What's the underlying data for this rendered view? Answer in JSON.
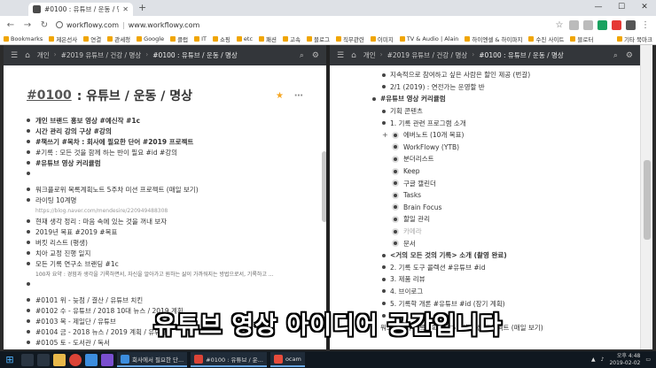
{
  "browser": {
    "tab_title": "#0100 : 유튜브 / 운동 / 명",
    "url_host": "workflowy.com",
    "url_sep": "|",
    "url_domain": "www.workflowy.com",
    "bookmarks": [
      "Bookmarks",
      "제은선사",
      "연결",
      "관세청",
      "Google",
      "클럽",
      "IT",
      "쇼핑",
      "etc",
      "패션",
      "고속",
      "블로그",
      "직무관련",
      "이미지",
      "TV & Audio | Alain",
      "하이엔셀 & 하이파지",
      "수진 사이트",
      "블로터"
    ],
    "bookmarks_right": "기타 북마크"
  },
  "left": {
    "crumbs": [
      "개인",
      "#2019 유튜브 / 건강 / 명상",
      "#0100 : 유튜브 / 운동 / 명상"
    ],
    "title_tag": "#0100",
    "title_rest": ": 유튜브 / 운동 / 명상",
    "rows": [
      {
        "text": "개인 브랜드 홍보 영상 #예신작 #1c",
        "style": "bold"
      },
      {
        "text": "시간 관리 강의 구상 #강의",
        "style": "bold"
      },
      {
        "text": "#책쓰기 #목차 : 회사에 필요한 단어 #2019 프로젝트",
        "style": "bold"
      },
      {
        "text": "#기록 : 모든 것을 함께 하는 반이 필요 #id #강의",
        "style": ""
      },
      {
        "text": "#유튜브 영상 커리큘럼",
        "style": "bold"
      },
      {
        "text": "",
        "style": ""
      },
      {
        "text": "워크플로위 목록계획노트 5주차 미션 프로젝트 (매일 보기)",
        "style": "gap"
      },
      {
        "text": "라이팅 10계명",
        "style": ""
      },
      {
        "text": "https://blog.naver.com/mendesire/220949488308",
        "style": "link"
      },
      {
        "text": "현재 생각 정리 : 마음 속에 있는 것을 꺼내 보자",
        "style": ""
      },
      {
        "text": "2019년 목표 #2019 #목표",
        "style": ""
      },
      {
        "text": "버킷 리스트 (평생)",
        "style": ""
      },
      {
        "text": "치아 교정 진행 일지",
        "style": ""
      },
      {
        "text": "모든 기록 연구소 브랜딩 #1c",
        "style": ""
      },
      {
        "text": "100자 요약 : 경험과 생각을 기록하면서, 자신을 알아가고 원하는 삶이 가까워지는 방법으로서, 기록하고 ...",
        "style": "small"
      },
      {
        "text": "",
        "style": ""
      },
      {
        "text": "#0101 위 - 늦점 / 결산 / 유튜브 치킨",
        "style": "gap"
      },
      {
        "text": "#0102 수 - 유튜브 / 2018 10대 뉴스 / 2019 계획",
        "style": ""
      },
      {
        "text": "#0103 목 - 제일단 / 유튜브",
        "style": ""
      },
      {
        "text": "#0104 금 - 2018 뉴스 / 2019 계획 / 유튜브",
        "style": ""
      },
      {
        "text": "#0105 토 - 도서관 / 독서",
        "style": ""
      }
    ]
  },
  "right": {
    "crumbs": [
      "개인",
      "#2019 유튜브 / 건강 / 명상",
      "#0100 : 유튜브 / 운동 / 명상"
    ],
    "rows": [
      {
        "text": "지속적으로 참여하고 싶은 사람은 할인 제공 (번갈)",
        "indent": 1,
        "style": ""
      },
      {
        "text": "2/1 (2019) : 연전가는 운영할 반",
        "indent": 1,
        "style": ""
      },
      {
        "text": "#유튜브 영상 커리큘럼",
        "indent": 0,
        "style": "bold"
      },
      {
        "text": "기획 콘텐츠",
        "indent": 1,
        "style": ""
      },
      {
        "text": "1. 기록 관련 프로그램 소개",
        "indent": 1,
        "style": ""
      },
      {
        "text": "에버노트 (10개 목표)",
        "indent": 2,
        "style": "expand"
      },
      {
        "text": "WorkFlowy (YTB)",
        "indent": 2,
        "style": ""
      },
      {
        "text": "분더리스트",
        "indent": 2,
        "style": ""
      },
      {
        "text": "Keep",
        "indent": 2,
        "style": ""
      },
      {
        "text": "구글 캘린더",
        "indent": 2,
        "style": ""
      },
      {
        "text": "Tasks",
        "indent": 2,
        "style": ""
      },
      {
        "text": "Brain Focus",
        "indent": 2,
        "style": ""
      },
      {
        "text": "할일 관리",
        "indent": 2,
        "style": ""
      },
      {
        "text": "카메라",
        "indent": 2,
        "style": "dim"
      },
      {
        "text": "문서",
        "indent": 2,
        "style": ""
      },
      {
        "text": "<거의 모든 것의 기록> 소개 (촬영 완료)",
        "indent": 1,
        "style": "bold"
      },
      {
        "text": "2. 기록 도구 콜렉션 #유튜브 #id",
        "indent": 1,
        "style": ""
      },
      {
        "text": "3. 제품 리뷰",
        "indent": 1,
        "style": ""
      },
      {
        "text": "4. 브이로그",
        "indent": 1,
        "style": ""
      },
      {
        "text": "5. 기록학 개론 #유튜브 #id (장기 계획)",
        "indent": 1,
        "style": ""
      },
      {
        "text": "",
        "indent": 1,
        "style": ""
      },
      {
        "text": "워크플로위 목록계획노트 5주차 미션 프로젝트 (매일 보기)",
        "indent": 0,
        "style": ""
      }
    ]
  },
  "subtitle": "유튜브 영상 아이디어 공간입니다",
  "taskbar": {
    "tasks": [
      "회사에서 필요한 단...",
      "#0100 : 유튜브 / 운...",
      "ocam"
    ],
    "time": "오후 4:48",
    "date": "2019-02-02"
  }
}
